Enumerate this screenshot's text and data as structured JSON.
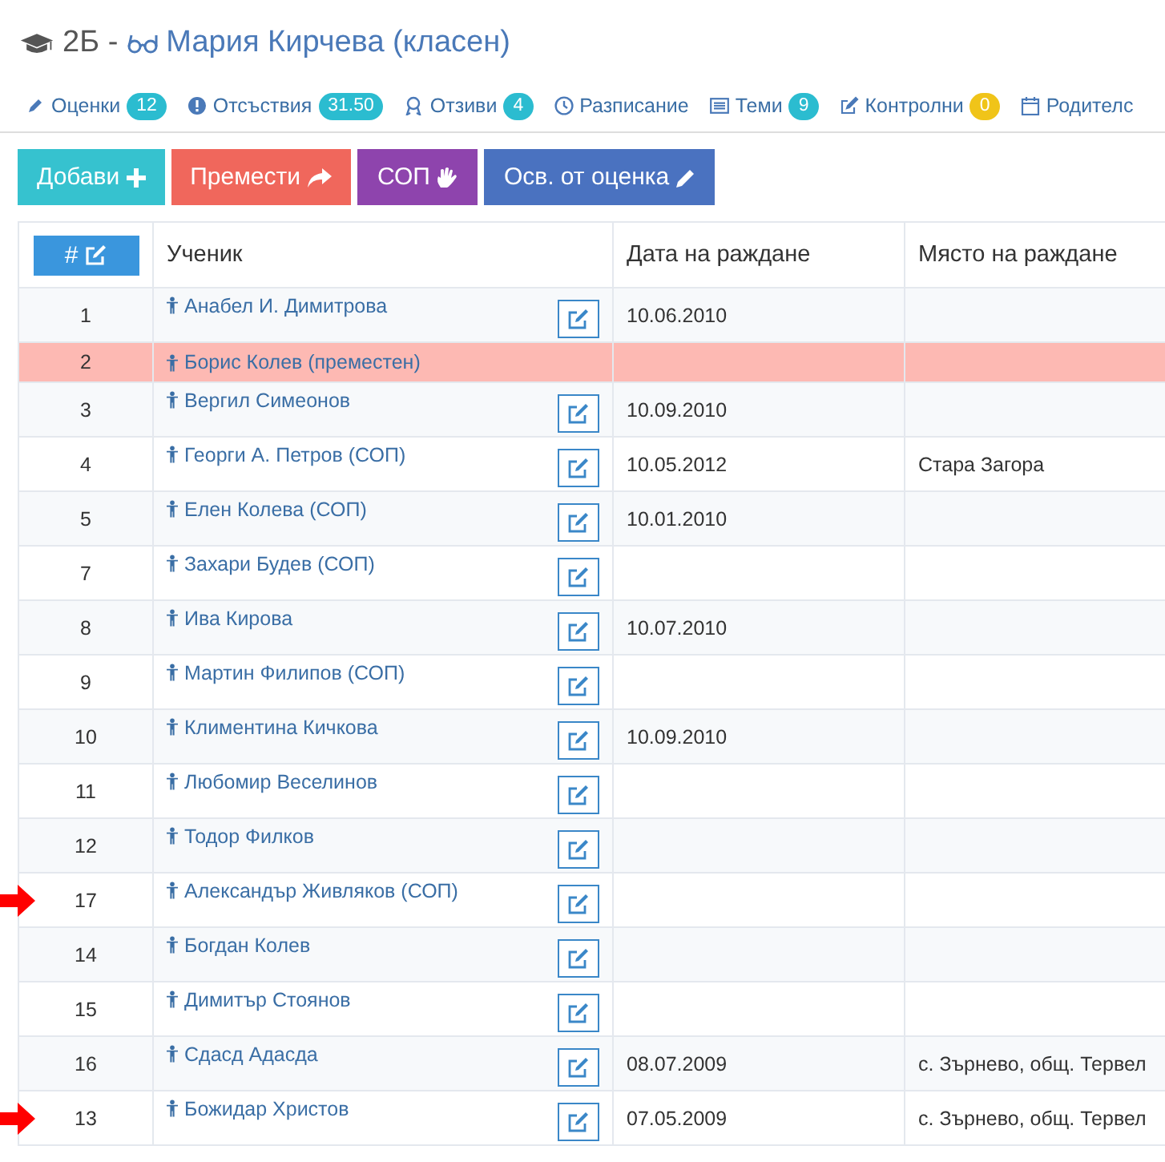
{
  "header": {
    "class_name": "2Б -",
    "teacher": "Мария Кирчева (класен)"
  },
  "tabs": [
    {
      "kind": "pencil",
      "label": "Оценки",
      "badge": "12",
      "color": "#2bbcd0"
    },
    {
      "kind": "exclamation",
      "label": "Отсъствия",
      "badge": "31.50",
      "color": "#2bbcd0"
    },
    {
      "kind": "ribbon",
      "label": "Отзиви",
      "badge": "4",
      "color": "#2bbcd0"
    },
    {
      "kind": "clock",
      "label": "Разписание"
    },
    {
      "kind": "list",
      "label": "Теми",
      "badge": "9",
      "color": "#2bbcd0"
    },
    {
      "kind": "edit",
      "label": "Контролни",
      "badge": "0",
      "color": "#f0c419"
    },
    {
      "kind": "calendar",
      "label": "Родителс"
    }
  ],
  "actions": [
    {
      "label": "Добави",
      "kind": "add",
      "color": "#36c2cf"
    },
    {
      "label": "Премести",
      "kind": "move",
      "color": "#f0675c"
    },
    {
      "label": "СОП",
      "kind": "hand",
      "color": "#8e44ad"
    },
    {
      "label": "Осв. от оценка",
      "kind": "pencil",
      "color": "#4a72c0"
    }
  ],
  "table": {
    "columns": [
      "#",
      "Ученик",
      "Дата на раждане",
      "Място на раждане"
    ],
    "rows": [
      {
        "number": "1",
        "name": "Анабел И. Димитрова",
        "birth_date": "10.06.2010",
        "flagged": false,
        "moved": false
      },
      {
        "number": "2",
        "name": "Борис Колев (преместен)",
        "flagged": false,
        "moved": true
      },
      {
        "number": "3",
        "name": "Вергил Симеонов",
        "birth_date": "10.09.2010",
        "flagged": false,
        "moved": false
      },
      {
        "number": "4",
        "name": "Георги А. Петров (СОП)",
        "birth_date": "10.05.2012",
        "birth_place": "Стара Загора",
        "flagged": false,
        "moved": false
      },
      {
        "number": "5",
        "name": "Елен Колева (СОП)",
        "birth_date": "10.01.2010",
        "flagged": false,
        "moved": false
      },
      {
        "number": "7",
        "name": "Захари Будев (СОП)",
        "flagged": false,
        "moved": false
      },
      {
        "number": "8",
        "name": "Ива Кирова",
        "birth_date": "10.07.2010",
        "flagged": false,
        "moved": false
      },
      {
        "number": "9",
        "name": "Мартин Филипов (СОП)",
        "flagged": false,
        "moved": false
      },
      {
        "number": "10",
        "name": "Климентина Кичкова",
        "birth_date": "10.09.2010",
        "flagged": false,
        "moved": false
      },
      {
        "number": "11",
        "name": "Любомир Веселинов",
        "flagged": false,
        "moved": false
      },
      {
        "number": "12",
        "name": "Тодор Филков",
        "flagged": false,
        "moved": false
      },
      {
        "number": "17",
        "name": "Александър Живляков (СОП)",
        "flagged": true,
        "moved": false
      },
      {
        "number": "14",
        "name": "Богдан Колев",
        "flagged": false,
        "moved": false
      },
      {
        "number": "15",
        "name": "Димитър Стоянов",
        "flagged": false,
        "moved": false
      },
      {
        "number": "16",
        "name": "Сдасд Адасда",
        "birth_date": "08.07.2009",
        "birth_place": "с. Зърнево, общ. Тервел",
        "flagged": false,
        "moved": false
      },
      {
        "number": "13",
        "name": "Божидар Христов",
        "birth_date": "07.05.2009",
        "birth_place": "с. Зърнево, общ. Тервел",
        "flagged": true,
        "moved": false
      }
    ]
  }
}
